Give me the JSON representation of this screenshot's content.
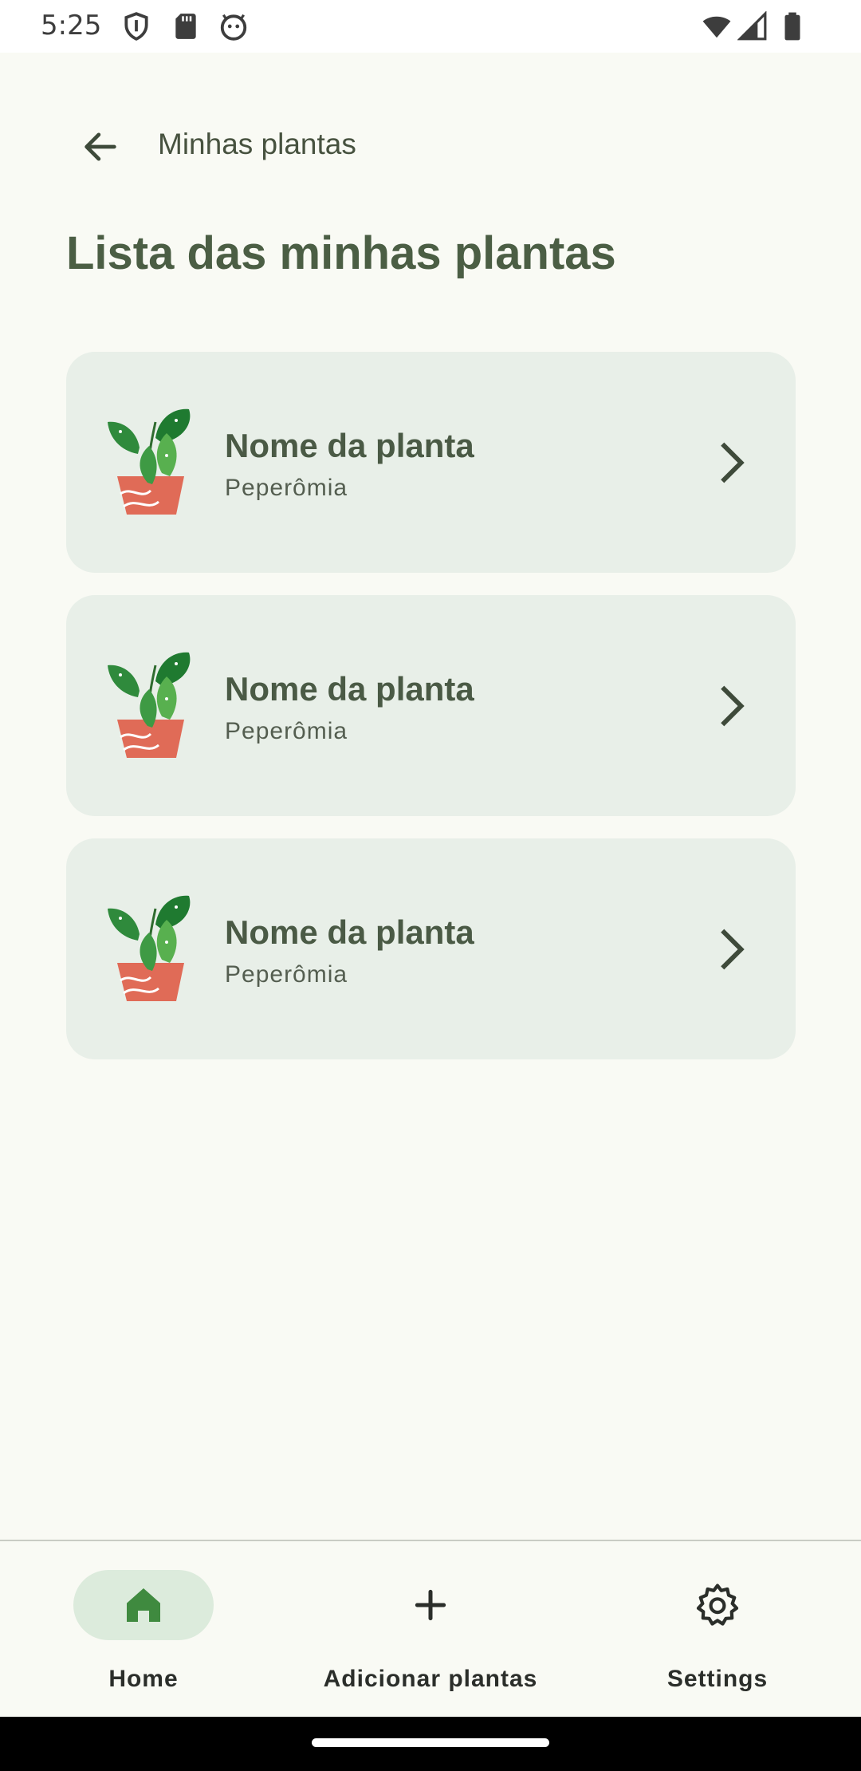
{
  "status_bar": {
    "time": "5:25",
    "left_icons": [
      "shield-icon",
      "sd-card-icon",
      "robot-face-icon"
    ],
    "right_icons": [
      "wifi-icon",
      "signal-icon",
      "battery-icon"
    ]
  },
  "toolbar": {
    "back_icon": "arrow-back-icon",
    "title": "Minhas plantas"
  },
  "page": {
    "title": "Lista das minhas plantas"
  },
  "plants": [
    {
      "name": "Nome da planta",
      "species": "Peperômia"
    },
    {
      "name": "Nome da planta",
      "species": "Peperômia"
    },
    {
      "name": "Nome da planta",
      "species": "Peperômia"
    }
  ],
  "bottom_nav": {
    "items": [
      {
        "label": "Home",
        "icon": "home-icon",
        "active": true
      },
      {
        "label": "Adicionar plantas",
        "icon": "plus-icon",
        "active": false
      },
      {
        "label": "Settings",
        "icon": "gear-icon",
        "active": false
      }
    ]
  },
  "colors": {
    "background": "#f9faf4",
    "card": "#e8efe8",
    "title_green": "#4b5e44",
    "active_indicator": "#dcebdc",
    "home_icon_green": "#3f8a3f",
    "pot_red": "#e06b57",
    "leaf_green": "#2f8a3c"
  }
}
